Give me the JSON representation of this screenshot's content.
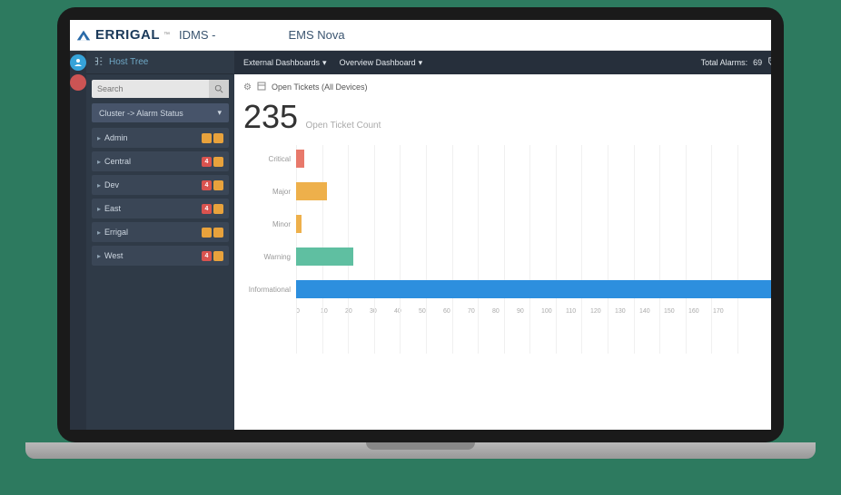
{
  "brand": {
    "name": "ERRIGAL",
    "tm": "™"
  },
  "header": {
    "app_name": "IDMS -",
    "page_title": "EMS Nova"
  },
  "sidebar": {
    "title": "Host Tree",
    "search_placeholder": "Search",
    "cluster_label": "Cluster -> Alarm Status",
    "items": [
      {
        "label": "Admin",
        "red": null,
        "orange": true,
        "orange2": true
      },
      {
        "label": "Central",
        "red": "4",
        "orange": true,
        "orange2": false
      },
      {
        "label": "Dev",
        "red": "4",
        "orange": true,
        "orange2": false
      },
      {
        "label": "East",
        "red": "4",
        "orange": true,
        "orange2": false
      },
      {
        "label": "Errigal",
        "red": null,
        "orange": true,
        "orange2": true
      },
      {
        "label": "West",
        "red": "4",
        "orange": true,
        "orange2": false
      }
    ]
  },
  "navbar": {
    "items": [
      {
        "label": "External Dashboards"
      },
      {
        "label": "Overview Dashboard"
      }
    ],
    "total_alarms_label": "Total Alarms:",
    "total_alarms_value": "69"
  },
  "panel": {
    "title": "Open Tickets (All Devices)",
    "big_number": "235",
    "big_subtitle": "Open Ticket Count"
  },
  "chart_data": {
    "type": "bar",
    "orientation": "horizontal",
    "categories": [
      "Critical",
      "Major",
      "Minor",
      "Warning",
      "Informational"
    ],
    "values": [
      3,
      12,
      2,
      22,
      196
    ],
    "colors": [
      "#e8796b",
      "#eeb04b",
      "#eeb04b",
      "#5fbfa1",
      "#2d8fde"
    ],
    "xlabel": "",
    "ylabel": "",
    "xlim": [
      0,
      180
    ],
    "ticks": [
      0,
      10,
      20,
      30,
      40,
      50,
      60,
      70,
      80,
      90,
      100,
      110,
      120,
      130,
      140,
      150,
      160,
      170
    ]
  }
}
